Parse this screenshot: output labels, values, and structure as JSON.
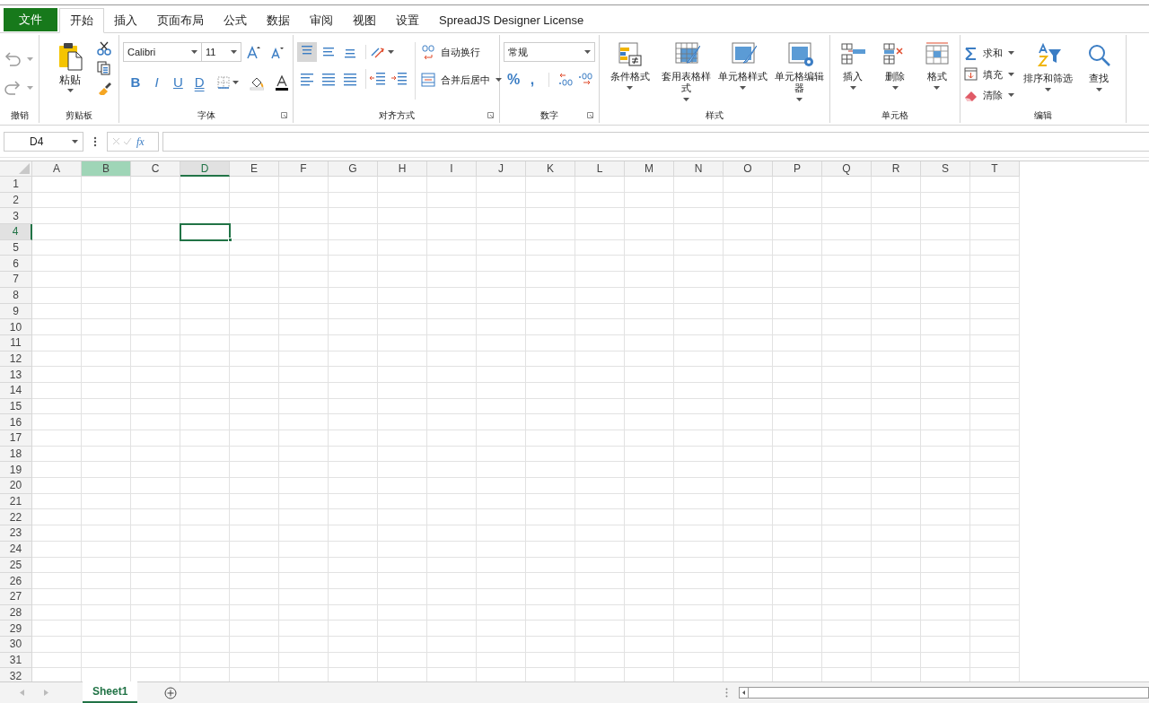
{
  "menu_tabs": [
    {
      "label": "文件",
      "kind": "file",
      "selected": false
    },
    {
      "label": "开始",
      "kind": "tab",
      "selected": true
    },
    {
      "label": "插入",
      "kind": "tab",
      "selected": false
    },
    {
      "label": "页面布局",
      "kind": "tab",
      "selected": false
    },
    {
      "label": "公式",
      "kind": "tab",
      "selected": false
    },
    {
      "label": "数据",
      "kind": "tab",
      "selected": false
    },
    {
      "label": "审阅",
      "kind": "tab",
      "selected": false
    },
    {
      "label": "视图",
      "kind": "tab",
      "selected": false
    },
    {
      "label": "设置",
      "kind": "tab",
      "selected": false
    },
    {
      "label": "SpreadJS Designer License",
      "kind": "tab",
      "selected": false
    }
  ],
  "ribbon": {
    "groups": [
      {
        "kind": "undo",
        "label": "撤销"
      },
      {
        "kind": "clipboard",
        "label": "剪贴板",
        "paste": "粘贴"
      },
      {
        "kind": "font",
        "label": "字体",
        "font_name": "Calibri",
        "font_size": "11",
        "style_buttons": [
          "B",
          "I",
          "U",
          "D"
        ]
      },
      {
        "kind": "alignment",
        "label": "对齐方式",
        "vertical_align": [
          {
            "selected": true
          },
          {
            "selected": false
          },
          {
            "selected": false
          }
        ],
        "wrap_text": "自动换行",
        "merge_center": "合并后居中"
      },
      {
        "kind": "number",
        "label": "数字",
        "format": "常规",
        "buttons": [
          "%",
          ","
        ]
      },
      {
        "kind": "large_buttons",
        "label": "样式",
        "buttons": [
          "条件格式",
          "套用表格样式",
          "单元格样式",
          "单元格编辑器"
        ]
      },
      {
        "kind": "large_buttons",
        "label": "单元格",
        "buttons": [
          "插入",
          "删除",
          "格式"
        ]
      },
      {
        "kind": "editing",
        "label": "编辑",
        "small_buttons": [
          "求和",
          "填充",
          "清除"
        ],
        "large_buttons": [
          "排序和筛选",
          "查找"
        ]
      }
    ]
  },
  "formula_bar": {
    "name_box": "D4",
    "fx": "fx"
  },
  "sheet": {
    "columns": [
      {
        "label": "A",
        "selected": false,
        "hovered": false
      },
      {
        "label": "B",
        "selected": false,
        "hovered": true
      },
      {
        "label": "C",
        "selected": false,
        "hovered": false
      },
      {
        "label": "D",
        "selected": true,
        "hovered": false
      },
      {
        "label": "E",
        "selected": false,
        "hovered": false
      },
      {
        "label": "F",
        "selected": false,
        "hovered": false
      },
      {
        "label": "G",
        "selected": false,
        "hovered": false
      },
      {
        "label": "H",
        "selected": false,
        "hovered": false
      },
      {
        "label": "I",
        "selected": false,
        "hovered": false
      },
      {
        "label": "J",
        "selected": false,
        "hovered": false
      },
      {
        "label": "K",
        "selected": false,
        "hovered": false
      },
      {
        "label": "L",
        "selected": false,
        "hovered": false
      },
      {
        "label": "M",
        "selected": false,
        "hovered": false
      },
      {
        "label": "N",
        "selected": false,
        "hovered": false
      },
      {
        "label": "O",
        "selected": false,
        "hovered": false
      },
      {
        "label": "P",
        "selected": false,
        "hovered": false
      },
      {
        "label": "Q",
        "selected": false,
        "hovered": false
      },
      {
        "label": "R",
        "selected": false,
        "hovered": false
      },
      {
        "label": "S",
        "selected": false,
        "hovered": false
      },
      {
        "label": "T",
        "selected": false,
        "hovered": false
      }
    ],
    "rows": [
      {
        "label": "1",
        "selected": false
      },
      {
        "label": "2",
        "selected": false
      },
      {
        "label": "3",
        "selected": false
      },
      {
        "label": "4",
        "selected": true
      },
      {
        "label": "5",
        "selected": false
      },
      {
        "label": "6",
        "selected": false
      },
      {
        "label": "7",
        "selected": false
      },
      {
        "label": "8",
        "selected": false
      },
      {
        "label": "9",
        "selected": false
      },
      {
        "label": "10",
        "selected": false
      },
      {
        "label": "11",
        "selected": false
      },
      {
        "label": "12",
        "selected": false
      },
      {
        "label": "13",
        "selected": false
      },
      {
        "label": "14",
        "selected": false
      },
      {
        "label": "15",
        "selected": false
      },
      {
        "label": "16",
        "selected": false
      },
      {
        "label": "17",
        "selected": false
      },
      {
        "label": "18",
        "selected": false
      },
      {
        "label": "19",
        "selected": false
      },
      {
        "label": "20",
        "selected": false
      },
      {
        "label": "21",
        "selected": false
      },
      {
        "label": "22",
        "selected": false
      },
      {
        "label": "23",
        "selected": false
      },
      {
        "label": "24",
        "selected": false
      },
      {
        "label": "25",
        "selected": false
      },
      {
        "label": "26",
        "selected": false
      },
      {
        "label": "27",
        "selected": false
      },
      {
        "label": "28",
        "selected": false
      },
      {
        "label": "29",
        "selected": false
      },
      {
        "label": "30",
        "selected": false
      },
      {
        "label": "31",
        "selected": false
      },
      {
        "label": "32",
        "selected": false
      }
    ]
  },
  "sheet_tabs": [
    {
      "label": "Sheet1",
      "selected": true
    }
  ]
}
